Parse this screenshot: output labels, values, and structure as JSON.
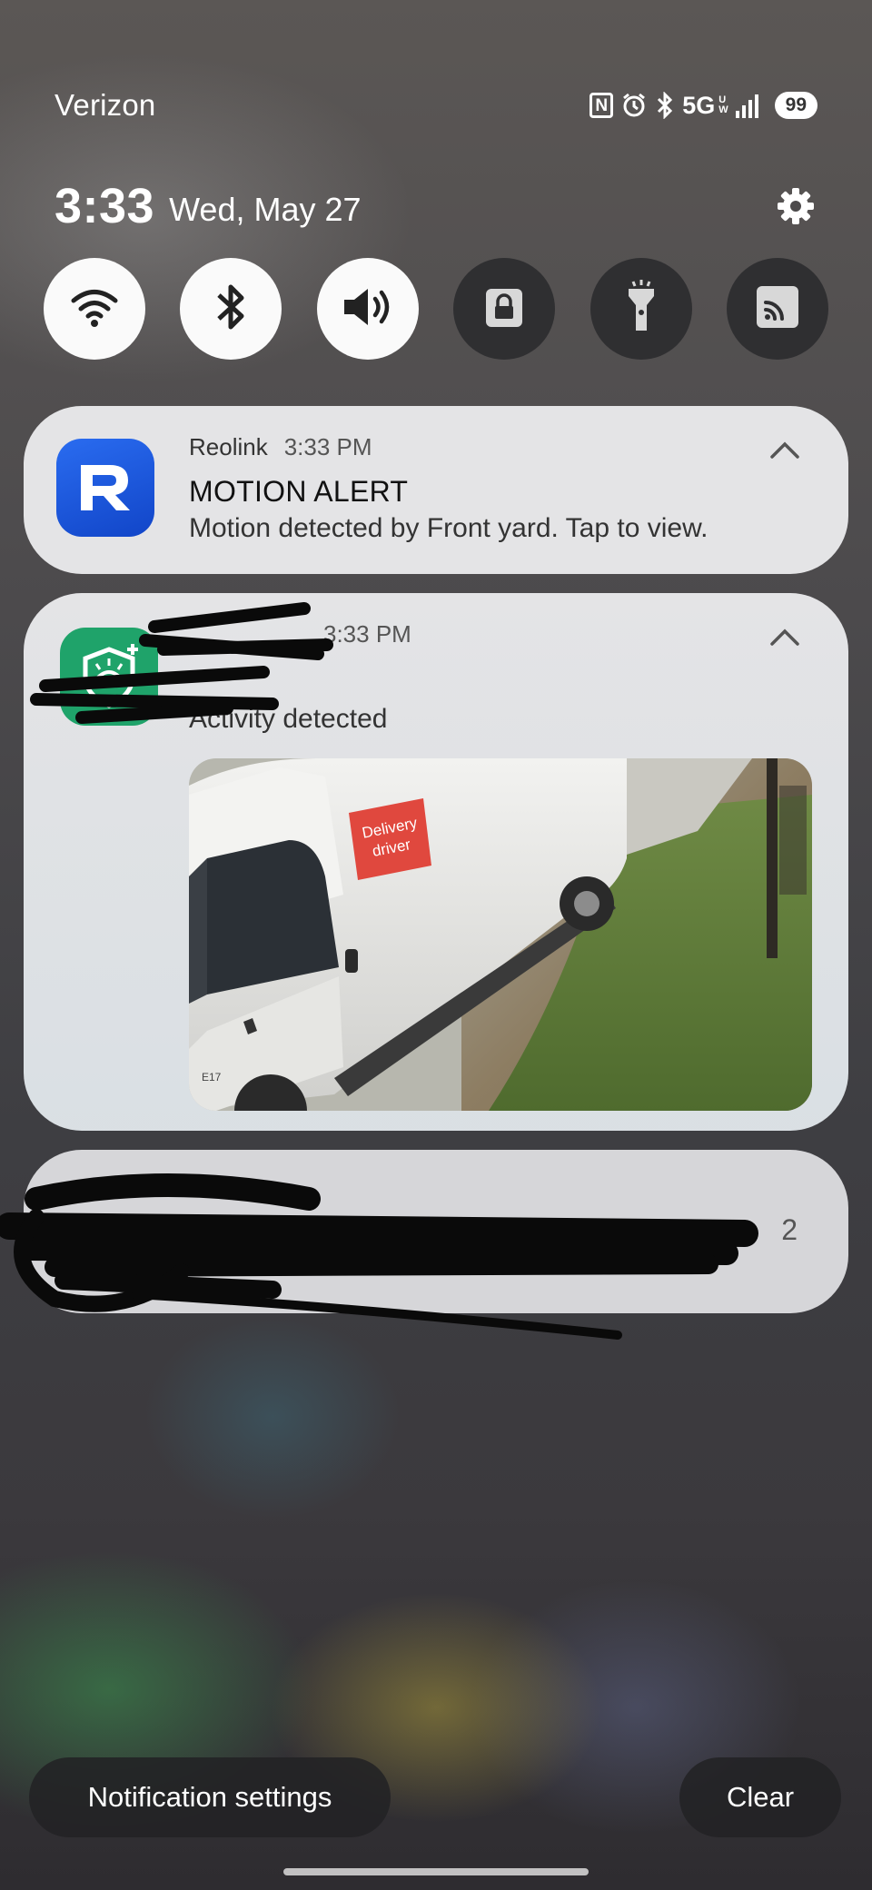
{
  "status_bar": {
    "carrier": "Verizon",
    "network": "5G",
    "network_suffix": [
      "U",
      "W"
    ],
    "battery": "99",
    "icons": [
      "nfc-icon",
      "alarm-icon",
      "bluetooth-icon",
      "signal-icon"
    ]
  },
  "header": {
    "time": "3:33",
    "date": "Wed, May 27"
  },
  "quick_toggles": [
    {
      "name": "wifi",
      "icon": "wifi-icon",
      "on": true
    },
    {
      "name": "bluetooth",
      "icon": "bluetooth-icon",
      "on": true
    },
    {
      "name": "sound",
      "icon": "speaker-icon",
      "on": true
    },
    {
      "name": "rotation-lock",
      "icon": "lock-icon",
      "on": false
    },
    {
      "name": "flashlight",
      "icon": "flashlight-icon",
      "on": false
    },
    {
      "name": "cast",
      "icon": "cast-icon",
      "on": false
    }
  ],
  "notifications": [
    {
      "app": "Reolink",
      "time": "3:33 PM",
      "title": "MOTION ALERT",
      "body": "Motion detected by Front yard. Tap to view.",
      "icon": "reolink-icon"
    },
    {
      "app": "",
      "time": "3:33 PM",
      "body": "Activity detected",
      "icon": "shield-app-icon",
      "image": {
        "badge_line1": "Delivery",
        "badge_line2": "driver",
        "plate": "E17"
      }
    },
    {
      "count": "2"
    }
  ],
  "footer": {
    "settings_label": "Notification settings",
    "clear_label": "Clear"
  },
  "colors": {
    "reolink_blue": "#1f5ee0",
    "app_green": "#1fa36a",
    "delivery_badge": "#e0483e"
  }
}
